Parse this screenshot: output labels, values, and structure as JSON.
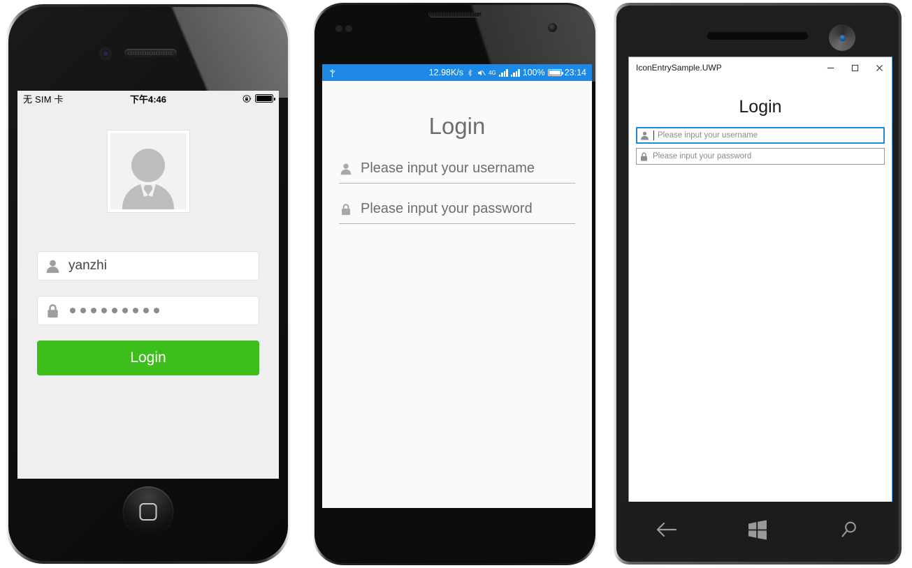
{
  "ios": {
    "status": {
      "carrier": "无 SIM 卡",
      "time": "下午4:46",
      "rotation_lock_icon": "rotation-lock-icon",
      "battery_icon": "battery-icon"
    },
    "avatar_icon": "user-avatar-icon",
    "username": {
      "icon": "person-icon",
      "value": "yanzhi"
    },
    "password": {
      "icon": "lock-icon",
      "dots": 9
    },
    "login_button": {
      "label": "Login",
      "color": "#3cbf1b"
    },
    "home_button_icon": "home-square-icon"
  },
  "android": {
    "status": {
      "usb_icon": "usb-icon",
      "network_speed": "12.98K/s",
      "bluetooth_icon": "bluetooth-icon",
      "mute_icon": "mute-icon",
      "network_type": "4G",
      "battery_percent": "100%",
      "battery_icon": "battery-icon",
      "time": "23:14"
    },
    "title": "Login",
    "username": {
      "icon": "person-icon",
      "placeholder": "Please input your username"
    },
    "password": {
      "icon": "lock-icon",
      "placeholder": "Please input your password"
    },
    "accent_color": "#1e88e5"
  },
  "uwp": {
    "window_title": "IconEntrySample.UWP",
    "window_controls": {
      "minimize": "─",
      "maximize": "☐",
      "close": "✕"
    },
    "title": "Login",
    "username": {
      "icon": "person-icon",
      "placeholder": "Please input your username",
      "focused": true
    },
    "password": {
      "icon": "lock-icon",
      "placeholder": "Please input your password",
      "focused": false
    },
    "navbar": {
      "back_icon": "back-arrow-icon",
      "start_icon": "windows-logo-icon",
      "search_icon": "search-icon"
    },
    "accent_color": "#1f8ad2"
  }
}
